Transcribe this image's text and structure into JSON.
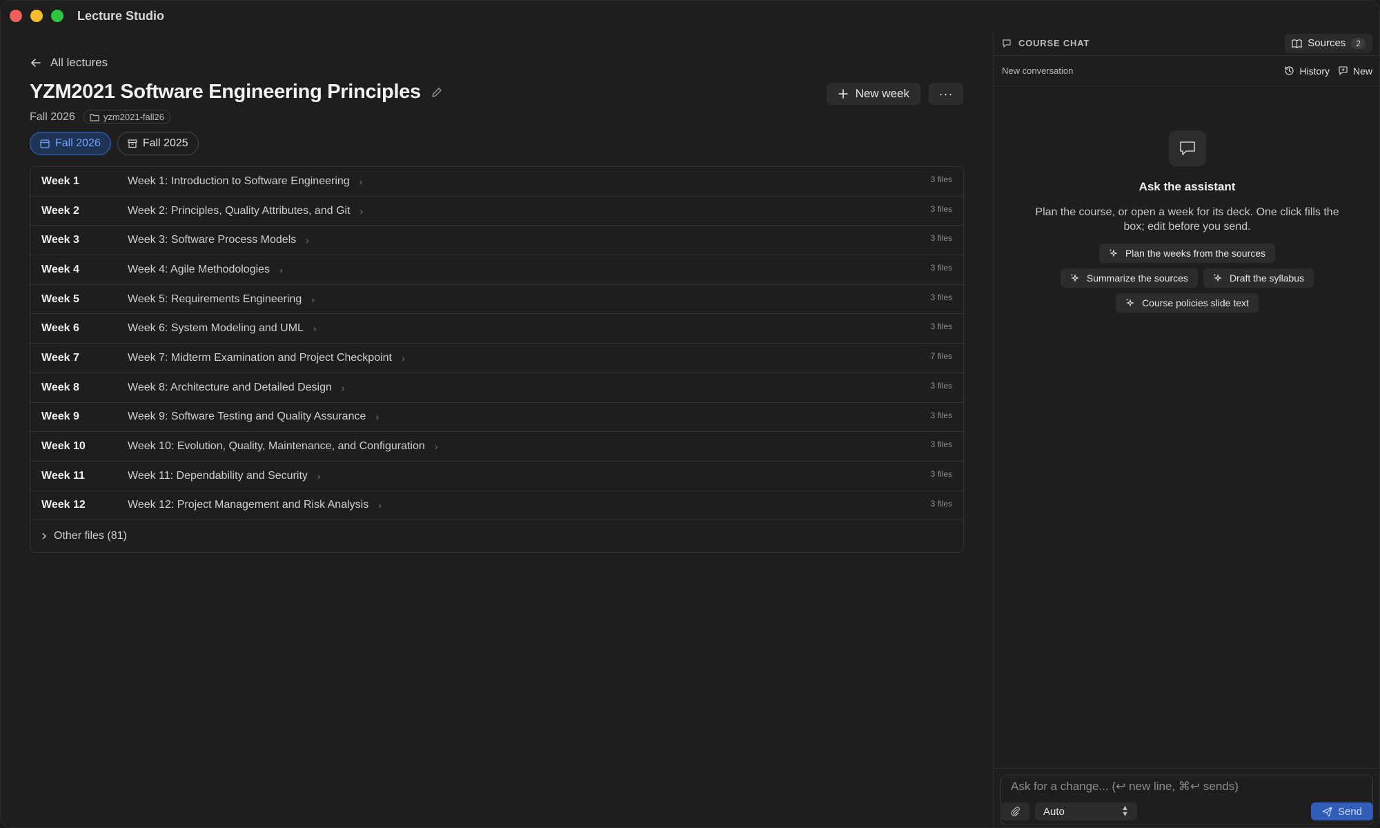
{
  "window": {
    "app_title": "Lecture Studio"
  },
  "nav": {
    "back_label": "All lectures"
  },
  "course": {
    "title": "YZM2021 Software Engineering Principles",
    "semester": "Fall 2026",
    "slug": "yzm2021-fall26"
  },
  "semesters": [
    {
      "label": "Fall 2026",
      "active": true
    },
    {
      "label": "Fall 2025",
      "active": false
    }
  ],
  "actions": {
    "new_week": "New week",
    "more": "···"
  },
  "weeks": [
    {
      "num": "Week 1",
      "title": "Week 1: Introduction to Software Engineering",
      "files": "3 files"
    },
    {
      "num": "Week 2",
      "title": "Week 2: Principles, Quality Attributes, and Git",
      "files": "3 files"
    },
    {
      "num": "Week 3",
      "title": "Week 3: Software Process Models",
      "files": "3 files"
    },
    {
      "num": "Week 4",
      "title": "Week 4: Agile Methodologies",
      "files": "3 files"
    },
    {
      "num": "Week 5",
      "title": "Week 5: Requirements Engineering",
      "files": "3 files"
    },
    {
      "num": "Week 6",
      "title": "Week 6: System Modeling and UML",
      "files": "3 files"
    },
    {
      "num": "Week 7",
      "title": "Week 7: Midterm Examination and Project Checkpoint",
      "files": "7 files"
    },
    {
      "num": "Week 8",
      "title": "Week 8: Architecture and Detailed Design",
      "files": "3 files"
    },
    {
      "num": "Week 9",
      "title": "Week 9: Software Testing and Quality Assurance",
      "files": "3 files"
    },
    {
      "num": "Week 10",
      "title": "Week 10: Evolution, Quality, Maintenance, and Configuration",
      "files": "3 files"
    },
    {
      "num": "Week 11",
      "title": "Week 11: Dependability and Security",
      "files": "3 files"
    },
    {
      "num": "Week 12",
      "title": "Week 12: Project Management and Risk Analysis",
      "files": "3 files"
    }
  ],
  "other_files": "Other files (81)",
  "chat": {
    "header": "COURSE CHAT",
    "sources_label": "Sources",
    "sources_count": "2",
    "conversation_title": "New conversation",
    "history_label": "History",
    "new_label": "New",
    "assistant_title": "Ask the assistant",
    "assistant_desc": "Plan the course, or open a week for its deck. One click fills the box; edit before you send.",
    "suggestions": [
      "Plan the weeks from the sources",
      "Summarize the sources",
      "Draft the syllabus",
      "Course policies slide text"
    ],
    "input_placeholder": "Ask for a change... (↩ new line, ⌘↩ sends)",
    "input_value": "",
    "mode": "Auto",
    "send_label": "Send"
  },
  "colors": {
    "accent": "#3a6bd1",
    "send": "#2f5db8",
    "background": "#1e1e1e"
  }
}
